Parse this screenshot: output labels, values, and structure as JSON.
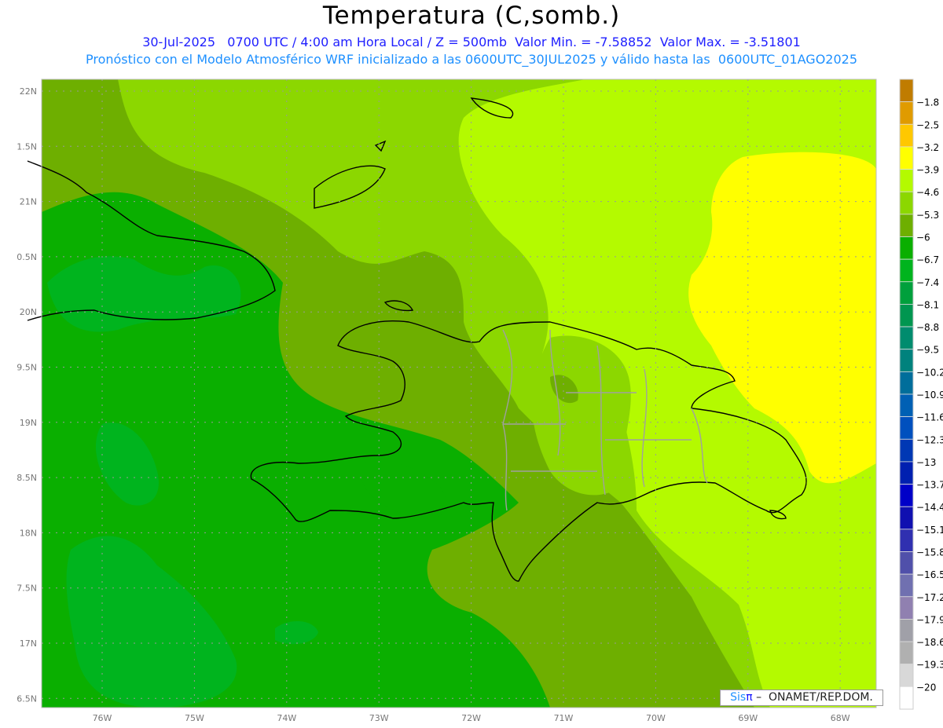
{
  "header": {
    "title": "Temperatura (C,somb.)",
    "line1": "30-Jul-2025   0700 UTC / 4:00 am Hora Local / Z = 500mb  Valor Min. = -7.58852  Valor Max. = -3.51801",
    "line2": "Pronóstico con el Modelo Atmosférico WRF inicializado a las 0600UTC_30JUL2025 y válido hasta las  0600UTC_01AGO2025"
  },
  "axes": {
    "lon_labels": [
      "76W",
      "75W",
      "74W",
      "73W",
      "72W",
      "71W",
      "70W",
      "69W",
      "68W"
    ],
    "lat_labels": [
      "22N",
      "1.5N",
      "21N",
      "0.5N",
      "20N",
      "9.5N",
      "19N",
      "8.5N",
      "18N",
      "7.5N",
      "17N",
      "6.5N"
    ]
  },
  "colorbar": {
    "labels": [
      "-1.8",
      "-2.5",
      "-3.2",
      "-3.9",
      "-4.6",
      "-5.3",
      "-6",
      "-6.7",
      "-7.4",
      "-8.1",
      "-8.8",
      "-9.5",
      "-10.2",
      "-10.9",
      "-11.6",
      "-12.3",
      "-13",
      "-13.7",
      "-14.4",
      "-15.1",
      "-15.8",
      "-16.5",
      "-17.2",
      "-17.9",
      "-18.6",
      "-19.3",
      "-20"
    ],
    "colors": [
      "#c07c00",
      "#e09b00",
      "#ffc800",
      "#ffff00",
      "#b4fa00",
      "#8cd700",
      "#6eaf00",
      "#0aaf00",
      "#00b41e",
      "#00a03c",
      "#009650",
      "#008c6e",
      "#00827d",
      "#006e9b",
      "#0060b4",
      "#0050be",
      "#0038b4",
      "#0020b0",
      "#0000c8",
      "#1010b0",
      "#3030b0",
      "#5050aa",
      "#7070b0",
      "#9080b0",
      "#a0a0a8",
      "#b0b0b0",
      "#d8d8d8",
      "#ffffff"
    ]
  },
  "credit": {
    "sis": "Sis",
    "pi": "π",
    "rest": " –  ONAMET/REP.DOM."
  }
}
